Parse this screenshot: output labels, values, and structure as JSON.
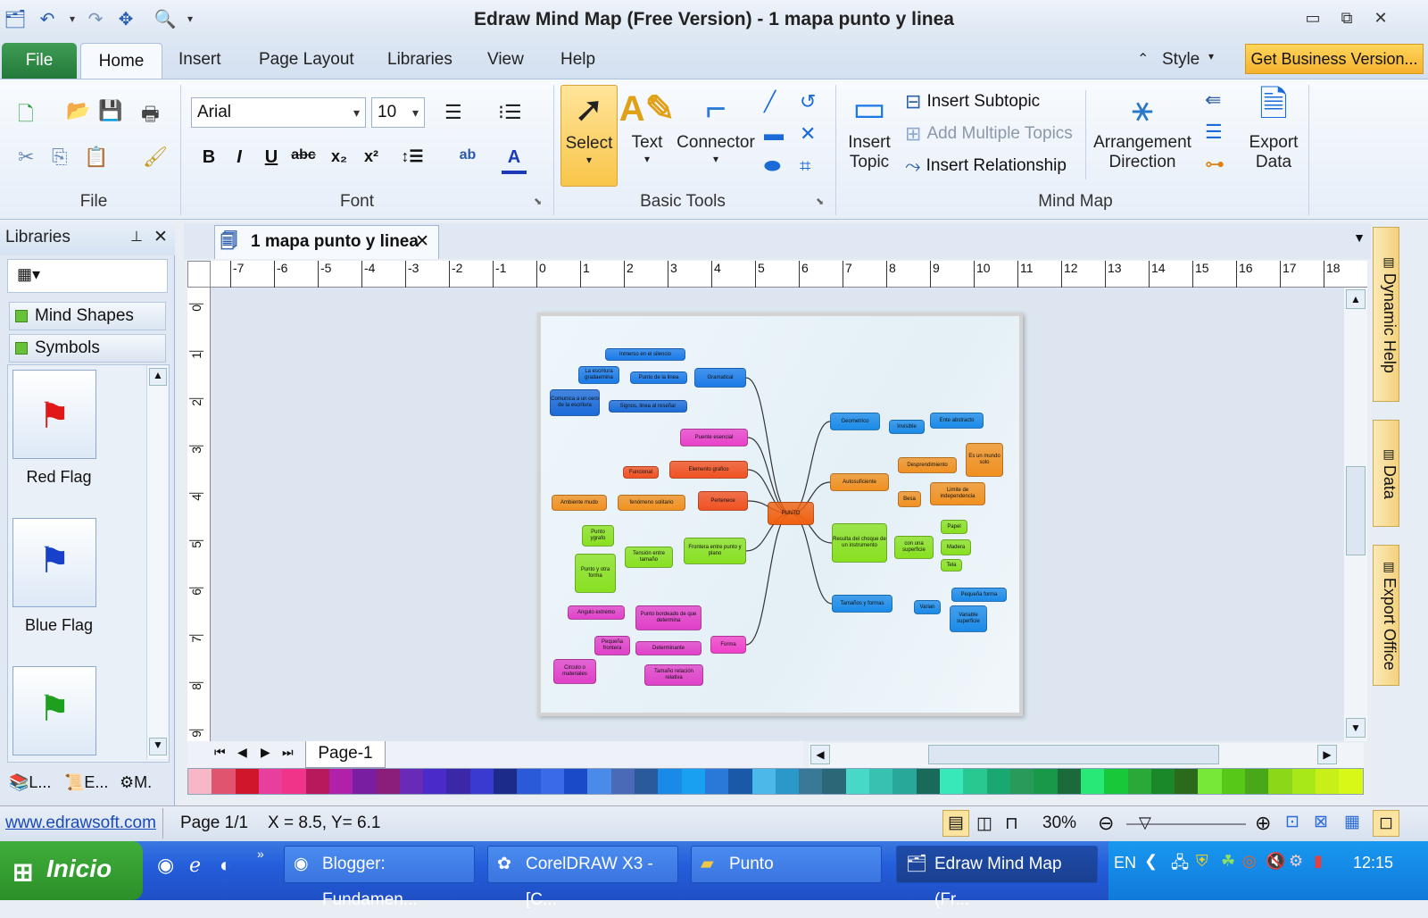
{
  "window": {
    "title": "Edraw Mind Map (Free Version) - 1 mapa punto y linea"
  },
  "tabs": {
    "file": "File",
    "items": [
      "Home",
      "Insert",
      "Page Layout",
      "Libraries",
      "View",
      "Help"
    ],
    "style": "Style",
    "get_business": "Get Business Version..."
  },
  "ribbon": {
    "groups": {
      "file": "File",
      "font": "Font",
      "basic_tools": "Basic Tools",
      "mind_map": "Mind Map"
    },
    "font_name": "Arial",
    "font_size": "10",
    "select": "Select",
    "text": "Text",
    "connector": "Connector",
    "insert_topic_1": "Insert",
    "insert_topic_2": "Topic",
    "insert_subtopic": "Insert Subtopic",
    "add_multiple_topics": "Add Multiple Topics",
    "insert_relationship": "Insert Relationship",
    "arrangement_1": "Arrangement",
    "arrangement_2": "Direction",
    "export_1": "Export",
    "export_2": "Data"
  },
  "libraries": {
    "header": "Libraries",
    "categories": [
      "Mind Shapes",
      "Symbols"
    ],
    "shapes": [
      {
        "label": "Red Flag",
        "color": "#e01818"
      },
      {
        "label": "Blue Flag",
        "color": "#1840c8"
      },
      {
        "label": "",
        "color": "#1ea01e"
      }
    ],
    "bottom_tabs": [
      "L...",
      "E...",
      "M."
    ]
  },
  "document": {
    "tab_title": "1 mapa punto y linea",
    "page_tab": "Page-1",
    "ruler_h": [
      "-7",
      "-6",
      "-5",
      "-4",
      "-3",
      "-2",
      "-1",
      "0",
      "1",
      "2",
      "3",
      "4",
      "5",
      "6",
      "7",
      "8",
      "9",
      "10",
      "11",
      "12",
      "13",
      "14",
      "15",
      "16",
      "17",
      "18"
    ],
    "ruler_v": [
      "0",
      "1",
      "2",
      "3",
      "4",
      "5",
      "6",
      "7",
      "8",
      "9"
    ]
  },
  "side_tabs": [
    "Dynamic Help",
    "Data",
    "Export Office"
  ],
  "palette": [
    "#f6b8c6",
    "#e0546f",
    "#d0162b",
    "#e83e9c",
    "#f0348a",
    "#b8185c",
    "#b020a8",
    "#7a1ea0",
    "#8a1e7a",
    "#6a2ab8",
    "#4a2ac8",
    "#3a28a8",
    "#3a3ad0",
    "#1c2a88",
    "#2a5ad8",
    "#3a6ae8",
    "#1a4ac8",
    "#4a8ae8",
    "#4a6ab8",
    "#2a5a9a",
    "#1a8ae8",
    "#1aa0f0",
    "#2a78d8",
    "#1a58a8",
    "#4ab8e8",
    "#2a98c8",
    "#3a7898",
    "#2a6878",
    "#48d8c8",
    "#38c0b0",
    "#28a898",
    "#1a6a5a",
    "#38e8b8",
    "#28c890",
    "#18a870",
    "#2a9a58",
    "#189848",
    "#1a6a3a",
    "#28e878",
    "#18c838",
    "#2aa838",
    "#1a8828",
    "#2a6a1a",
    "#78e838",
    "#58c818",
    "#48a818",
    "#8ad818",
    "#a8e818",
    "#c8f018",
    "#d8f818"
  ],
  "status": {
    "link": "www.edrawsoft.com",
    "page": "Page 1/1",
    "coords": "X = 8.5, Y= 6.1",
    "zoom": "30%"
  },
  "taskbar": {
    "start": "Inicio",
    "tasks": [
      "Blogger: Fundamen...",
      "CorelDRAW X3 - [C...",
      "Punto",
      "Edraw Mind Map (Fr..."
    ],
    "lang": "EN",
    "time": "12:15"
  },
  "mindmap": {
    "center": "PUNTO",
    "nodes": [
      "Inmerso en el silencio",
      "La escritura gradaemina",
      "Punto de la linea",
      "Gramatical",
      "Comunica a un cero de la escritura",
      "Signos, linea al reseñar",
      "Puente esencial",
      "Elemento grafico",
      "Funcional",
      "Pertenece",
      "Ambiente mudo",
      "fenómeno solitario",
      "Punto ygrafo",
      "Tensión entre tamaño",
      "Frontera entre punto y plano",
      "Punto y otra forma",
      "Forma",
      "Angulo extremo",
      "Punto bordeado de que determina",
      "Pequeña frontera",
      "Determinante",
      "Circulo o materiales",
      "Tamaño relación relativa",
      "Geometrico",
      "Invisible",
      "Ente abstracto",
      "Autosuficiente",
      "Desprendimiento",
      "Es un mundo solo",
      "Besa",
      "Limite de independencia",
      "Resulta del choque de un instrumento",
      "con una superficie",
      "Papel",
      "Madera",
      "Tela",
      "Tamaños y formas",
      "Varian",
      "Pequeña forma",
      "Variable superficie"
    ]
  }
}
